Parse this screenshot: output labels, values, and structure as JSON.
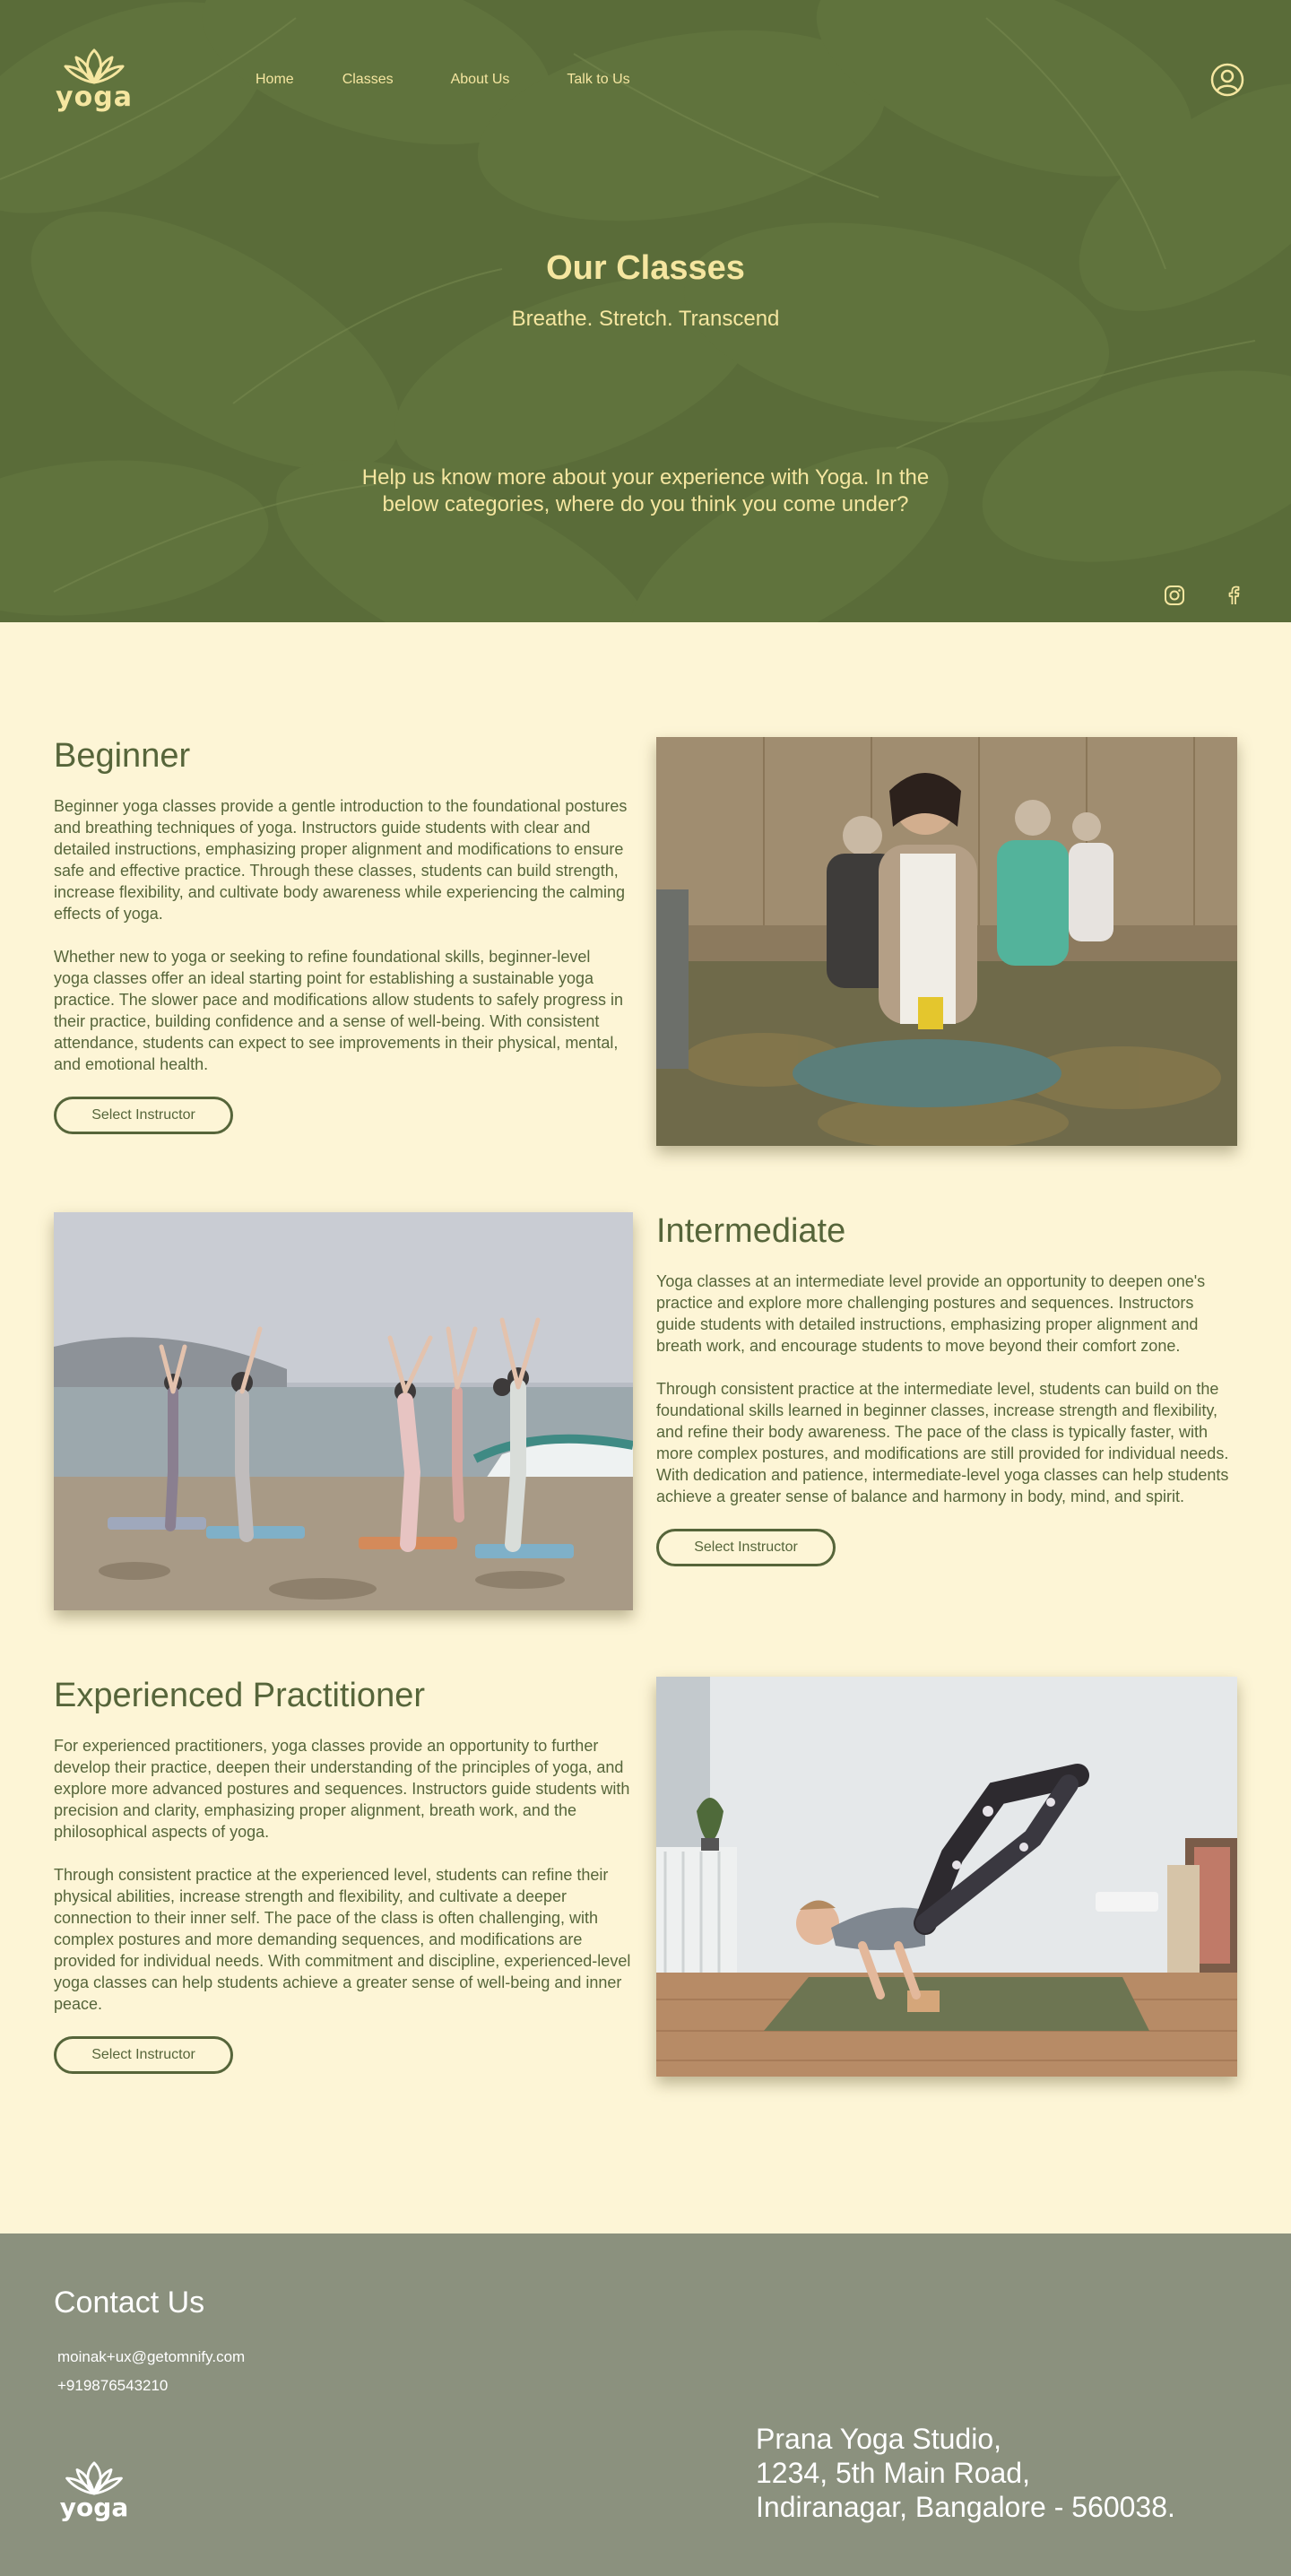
{
  "brand": {
    "logo_text": "yoga"
  },
  "nav": {
    "items": [
      "Home",
      "Classes",
      "About Us",
      "Talk to Us"
    ]
  },
  "hero": {
    "title": "Our Classes",
    "subtitle": "Breathe. Stretch. Transcend",
    "question": "Help us know more about your experience with Yoga. In the below categories, where do you think you come under?"
  },
  "icons": {
    "account": "user-circle-icon",
    "instagram": "instagram-icon",
    "facebook": "facebook-icon"
  },
  "classes": [
    {
      "title": "Beginner",
      "paragraphs": [
        "Beginner yoga classes provide a gentle introduction to the foundational postures and breathing techniques of yoga. Instructors guide students with clear and detailed instructions, emphasizing proper alignment and modifications to ensure safe and effective practice. Through these classes, students can build strength, increase flexibility, and cultivate body awareness while experiencing the calming effects of yoga.",
        "Whether new to yoga or seeking to refine foundational skills, beginner-level yoga classes offer an ideal starting point for establishing a sustainable yoga practice. The slower pace and modifications allow students to safely progress in their practice, building confidence and a sense of well-being. With consistent attendance, students can expect to see improvements in their physical, mental, and emotional health."
      ],
      "button": "Select Instructor"
    },
    {
      "title": "Intermediate",
      "paragraphs": [
        "Yoga classes at an intermediate level provide an opportunity to deepen one's practice and explore more challenging postures and sequences. Instructors guide students with detailed instructions, emphasizing proper alignment and breath work, and encourage students to move beyond their comfort zone.",
        "Through consistent practice at the intermediate level, students can build on the foundational skills learned in beginner classes, increase strength and flexibility, and refine their body awareness. The pace of the class is typically faster, with more complex postures, and modifications are still provided for individual needs. With dedication and patience, intermediate-level yoga classes can help students achieve a greater sense of balance and harmony in body, mind, and spirit."
      ],
      "button": "Select Instructor"
    },
    {
      "title": "Experienced Practitioner",
      "paragraphs": [
        "For experienced practitioners, yoga classes provide an opportunity to further develop their practice, deepen their understanding of the principles of yoga, and explore more advanced postures and sequences. Instructors guide students with precision and clarity, emphasizing proper alignment, breath work, and the philosophical aspects of yoga.",
        "Through consistent practice at the experienced level, students can refine their physical abilities, increase strength and flexibility, and cultivate a deeper connection to their inner self. The pace of the class is often challenging, with complex postures and more demanding sequences, and modifications are provided for individual needs. With commitment and discipline, experienced-level yoga classes can help students achieve a greater sense of well-being and inner peace."
      ],
      "button": "Select Instructor"
    }
  ],
  "footer": {
    "heading": "Contact Us",
    "email": "moinak+ux@getomnify.com",
    "phone": "+919876543210",
    "address": [
      "Prana Yoga Studio,",
      "1234, 5th Main Road,",
      "Indiranagar, Bangalore - 560038."
    ]
  },
  "colors": {
    "hero_bg": "#5a6c39",
    "hero_text": "#f5e6a0",
    "page_bg": "#fdf5d6",
    "heading": "#56653a",
    "footer_bg": "#8b917e"
  }
}
